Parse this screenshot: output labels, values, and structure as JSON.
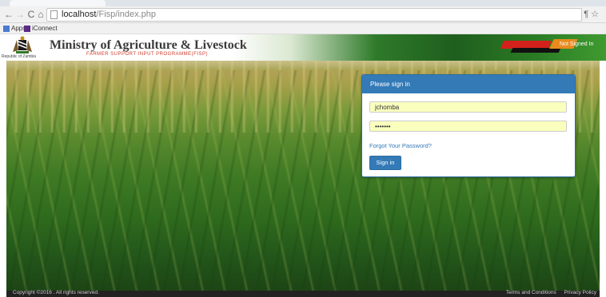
{
  "browser": {
    "url_host": "localhost",
    "url_path": "/Fisp/index.php",
    "bookmarks": [
      {
        "label": "Apps",
        "icon": "apps-grid-icon",
        "color": "#4a7bd0"
      },
      {
        "label": "iConnect",
        "icon": "yahoo-icon",
        "color": "#5b2a86"
      }
    ]
  },
  "header": {
    "coat_caption": "Republic of Zambia",
    "ministry": "Ministry of Agriculture & Livestock",
    "subtitle": "FARMER SUPPORT INPUT PROGRAMME(FISP)",
    "signin_note": "Not Signed In"
  },
  "login": {
    "title": "Please sign in",
    "username": "jchomba",
    "password_mask": "•••••••",
    "forgot": "Forgot Your Password?",
    "submit": "Sign in"
  },
  "footer": {
    "copyright": "Copyright ©2016 . All rights reserved.",
    "terms": "Terms and Conditions",
    "privacy": "Privacy Policy"
  },
  "colors": {
    "primary": "#337ab7",
    "autofill": "#faffbd",
    "subtitle_red": "#d13a2a"
  }
}
